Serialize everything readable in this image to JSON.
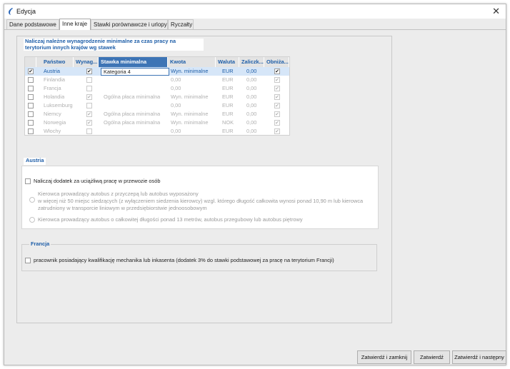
{
  "window": {
    "title": "Edycja"
  },
  "tabs": [
    {
      "label": "Dane podstawowe"
    },
    {
      "label": "Inne kraje"
    },
    {
      "label": "Stawki porównawcze i urlopy"
    },
    {
      "label": "Ryczałty"
    }
  ],
  "grid_title": "Naliczaj należne wynagrodzenie minimalne za czas pracy na terytorium innych krajów wg stawek",
  "columns": [
    "Państwo",
    "Wynag...",
    "Stawka minimalna",
    "Kwota",
    "Waluta",
    "Zaliczk...",
    "Obniża..."
  ],
  "rows": [
    {
      "checked": true,
      "country": "Austria",
      "wynag": true,
      "stawka": "Kategoria 4",
      "kwota": "Wyn. minimalne",
      "waluta": "EUR",
      "zaliczka": "0,00",
      "obniza": true,
      "active": true
    },
    {
      "checked": false,
      "country": "Finlandia",
      "wynag": false,
      "stawka": "",
      "kwota": "0,00",
      "waluta": "EUR",
      "zaliczka": "0,00",
      "obniza": true,
      "active": false
    },
    {
      "checked": false,
      "country": "Francja",
      "wynag": false,
      "stawka": "",
      "kwota": "0,00",
      "waluta": "EUR",
      "zaliczka": "0,00",
      "obniza": true,
      "active": false
    },
    {
      "checked": false,
      "country": "Holandia",
      "wynag": true,
      "stawka": "Ogólna płaca minimalna",
      "kwota": "Wyn. minimalne",
      "waluta": "EUR",
      "zaliczka": "0,00",
      "obniza": true,
      "active": false
    },
    {
      "checked": false,
      "country": "Luksemburg",
      "wynag": false,
      "stawka": "",
      "kwota": "0,00",
      "waluta": "EUR",
      "zaliczka": "0,00",
      "obniza": true,
      "active": false
    },
    {
      "checked": false,
      "country": "Niemcy",
      "wynag": true,
      "stawka": "Ogólna płaca minimalna",
      "kwota": "Wyn. minimalne",
      "waluta": "EUR",
      "zaliczka": "0,00",
      "obniza": true,
      "active": false
    },
    {
      "checked": false,
      "country": "Norwegia",
      "wynag": true,
      "stawka": "Ogólna płaca minimalna",
      "kwota": "Wyn. minimalne",
      "waluta": "NOK",
      "zaliczka": "0,00",
      "obniza": true,
      "active": false
    },
    {
      "checked": false,
      "country": "Włochy",
      "wynag": false,
      "stawka": "",
      "kwota": "0,00",
      "waluta": "EUR",
      "zaliczka": "0,00",
      "obniza": true,
      "active": false
    }
  ],
  "austria": {
    "title": "Austria",
    "main_option": "Naliczaj dodatek za uciążliwą pracę w przewozie osób",
    "radio1_line1": "Kierowca prowadzący autobus z przyczepą lub autobus wyposażony",
    "radio1_line2": "w więcej niż 50 miejsc siedzących (z wyłączeniem siedzenia kierowcy) wzgl. którego długość całkowita wynosi ponad 10,90 m lub kierowca",
    "radio1_line3": "zatrudniony w transporcie liniowym w przedsiębiorstwie jednoosobowym",
    "radio2": "Kierowca prowadzący autobus o całkowitej długości ponad 13 metrów, autobus przegubowy lub autobus piętrowy"
  },
  "france": {
    "title": "Francja",
    "option": "pracownik posiadający kwalifikację mechanika lub inkasenta (dodatek 3% do stawki podstawowej za pracę na terytorium Francji)"
  },
  "buttons": {
    "confirm_close": "Zatwierdź i zamknij",
    "confirm": "Zatwierdź",
    "confirm_next": "Zatwierdź i następny"
  },
  "colors": {
    "accent": "#1e5ea8",
    "header_selected": "#3d74b5",
    "row_selected": "#d6e6f8"
  },
  "icons": {
    "app": "app-icon",
    "close": "close-icon",
    "check": "checkmark-icon"
  }
}
